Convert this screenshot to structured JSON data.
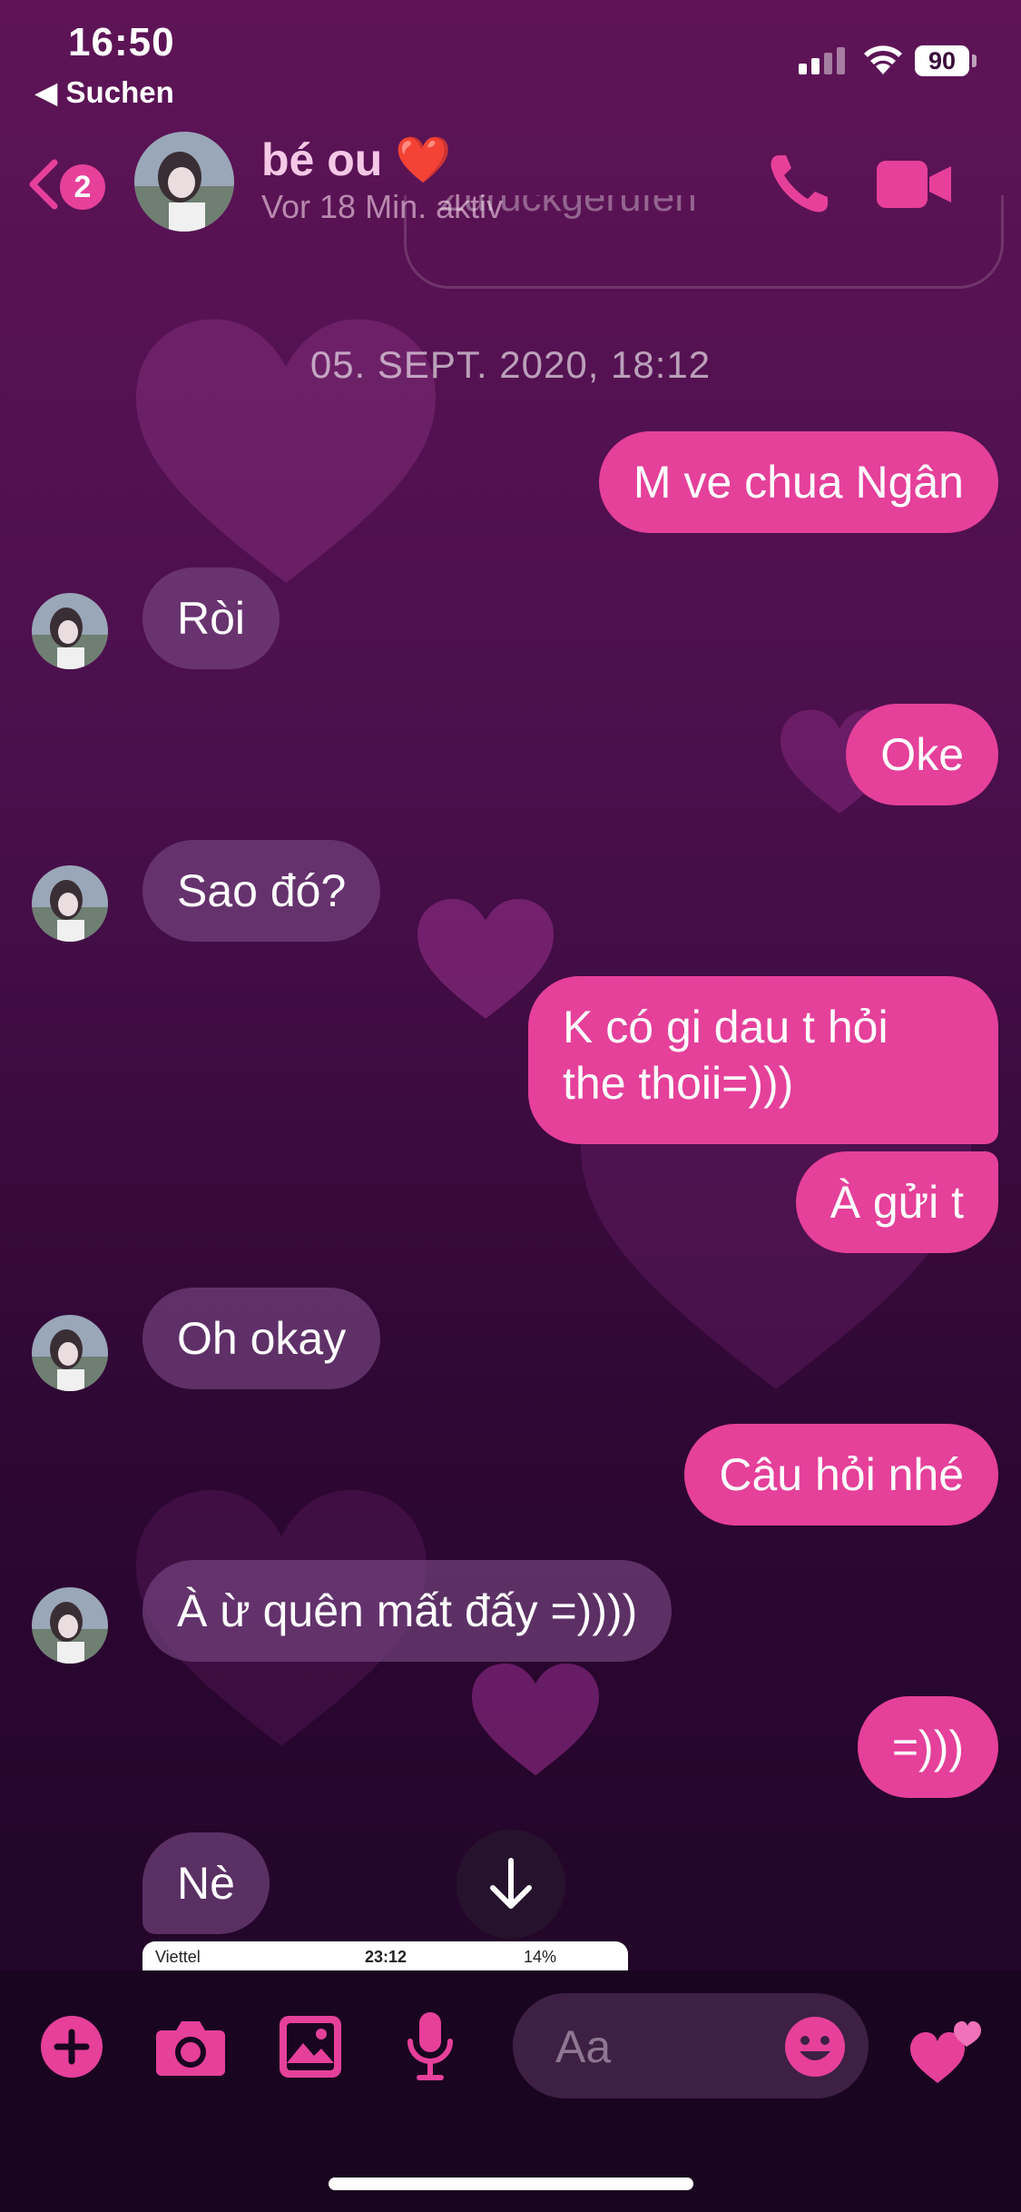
{
  "status_bar": {
    "time": "16:50",
    "back_app": "◀ Suchen",
    "battery": "90"
  },
  "header": {
    "unread_count": "2",
    "contact_name": "bé ou ❤️",
    "contact_status": "Vor 18 Min. aktiv"
  },
  "recall_text": "Zurückgerufen",
  "date_separator": "05. SEPT. 2020, 18:12",
  "messages": [
    {
      "from": "me",
      "text": "M ve chua Ngân"
    },
    {
      "from": "them",
      "text": "Ròi"
    },
    {
      "from": "me",
      "text": "Oke"
    },
    {
      "from": "them",
      "text": "Sao đó?"
    },
    {
      "from": "me",
      "text_lines": [
        "K có gi dau t hỏi",
        "the thoii=)))"
      ]
    },
    {
      "from": "me",
      "text": "À gửi t"
    },
    {
      "from": "them",
      "text": "Oh okay"
    },
    {
      "from": "me",
      "text": "Câu hỏi nhé"
    },
    {
      "from": "them",
      "text": "À ừ quên mất đấy =))))"
    },
    {
      "from": "me",
      "text": "=)))"
    },
    {
      "from": "them",
      "text": "Nè"
    }
  ],
  "attachment_preview": {
    "carrier": "Viettel",
    "time": "23:12",
    "battery": "14%"
  },
  "composer": {
    "placeholder": "Aa"
  },
  "colors": {
    "accent": "#e5409a",
    "background_top": "#5e1457",
    "background_bottom": "#1d0524"
  },
  "icons": [
    "add-icon",
    "camera-icon",
    "gallery-icon",
    "microphone-icon",
    "emoji-icon",
    "hearts-like-icon",
    "phone-icon",
    "video-icon",
    "back-chevron-icon",
    "arrow-down-icon"
  ]
}
